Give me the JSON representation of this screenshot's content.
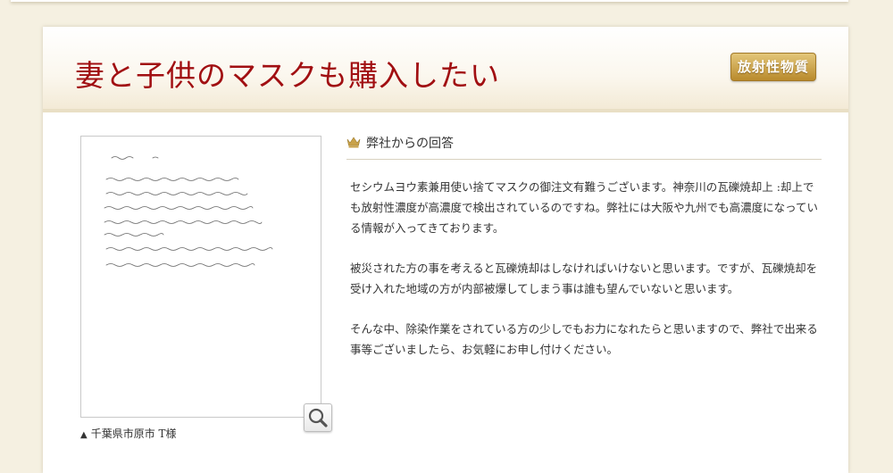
{
  "header": {
    "title": "妻と子供のマスクも購入したい",
    "badge": "放射性物質"
  },
  "letter": {
    "caption": "千葉県市原市 T様",
    "zoom_icon": "magnifier-icon"
  },
  "answer": {
    "heading": "弊社からの回答",
    "heading_icon": "crown-icon",
    "paragraphs": [
      "セシウムヨウ素兼用使い捨てマスクの御注文有難うございます。神奈川の瓦礫焼却上 :却上でも放射性濃度が高濃度で検出されているのですね。弊社には大阪や九州でも高濃度になっている情報が入ってきております。",
      "被災された方の事を考えると瓦礫焼却はしなければいけないと思います。ですが、瓦礫焼却を受け入れた地域の方が内部被爆してしまう事は誰も望んでいないと思います。",
      "そんな中、除染作業をされている方の少しでもお力になれたらと思いますので、弊社で出来る事等ございましたら、お気軽にお申し付けください。"
    ]
  },
  "colors": {
    "title": "#a10f12",
    "badge_gold": "#c9a24a",
    "background": "#f5f0e1"
  }
}
